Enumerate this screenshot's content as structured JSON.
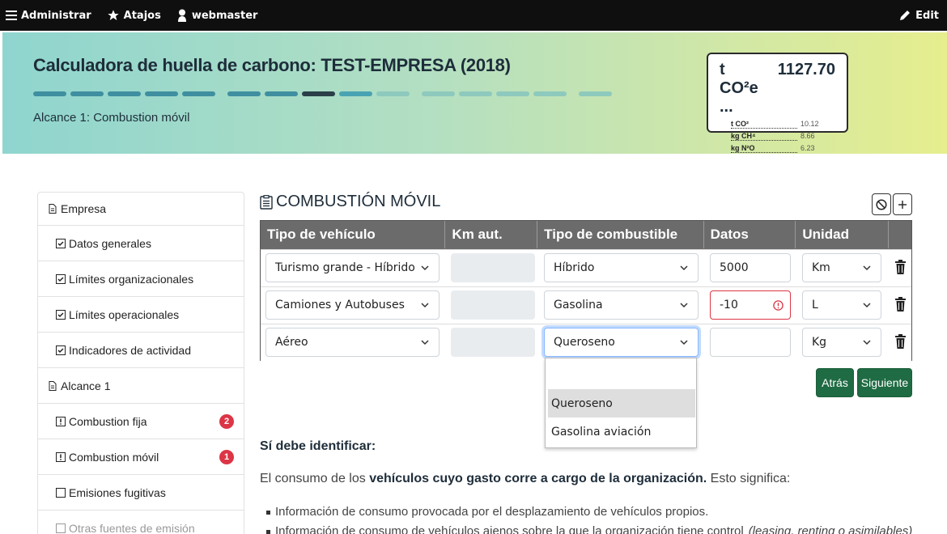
{
  "topbar": {
    "administrar": "Administrar",
    "atajos": "Atajos",
    "user": "webmaster",
    "edit": "Edit"
  },
  "hero": {
    "title": "Calculadora de huella de carbono: TEST-EMPRESA (2018)",
    "subtitle": "Alcance 1: Combustion móvil",
    "co2_label": "t CO²e ...",
    "co2_total": "1127.70",
    "rows": [
      {
        "label": "t CO²",
        "value": "10.12"
      },
      {
        "label": "kg CH⁴",
        "value": "8.66"
      },
      {
        "label": "kg N²O",
        "value": "6.23"
      }
    ],
    "progress_colors": {
      "done": "#3f8fa0",
      "current": "#2a3f48",
      "pending": "#8ec9bd",
      "next": "#4aa3b3"
    }
  },
  "sidebar": {
    "items": [
      {
        "label": "Empresa",
        "icon": "file-icon",
        "level": 1
      },
      {
        "label": "Datos generales",
        "icon": "check-square-icon",
        "level": 2
      },
      {
        "label": "Límites organizacionales",
        "icon": "check-square-icon",
        "level": 2
      },
      {
        "label": "Límites operacionales",
        "icon": "check-square-icon",
        "level": 2
      },
      {
        "label": "Indicadores de actividad",
        "icon": "check-square-icon",
        "level": 2
      },
      {
        "label": "Alcance 1",
        "icon": "file-icon",
        "level": 1
      },
      {
        "label": "Combustion fija",
        "icon": "exclamation-square-icon",
        "level": 2,
        "badge": "2"
      },
      {
        "label": "Combustion móvil",
        "icon": "exclamation-square-icon",
        "level": 2,
        "badge": "1"
      },
      {
        "label": "Emisiones fugitivas",
        "icon": "square-icon",
        "level": 2
      },
      {
        "label": "Otras fuentes de emisión",
        "icon": "square-icon",
        "level": 2
      }
    ]
  },
  "main": {
    "title": "COMBUSTIÓN MÓVIL",
    "columns": [
      "Tipo de vehículo",
      "Km aut.",
      "Tipo de combustible",
      "Datos",
      "Unidad"
    ],
    "rows": [
      {
        "vehicle": "Turismo grande - Híbrido",
        "km": "",
        "fuel": "Híbrido",
        "data": "5000",
        "unit": "Km"
      },
      {
        "vehicle": "Camiones y Autobuses",
        "km": "",
        "fuel": "Gasolina",
        "data": "-10",
        "unit": "L"
      },
      {
        "vehicle": "Aéreo",
        "km": "",
        "fuel": "Queroseno",
        "data": "",
        "unit": "Kg"
      }
    ],
    "dropdown_options": [
      "",
      "Queroseno",
      "Gasolina aviación"
    ],
    "back_label": "Atrás",
    "next_label": "Siguiente",
    "info_heading": "Sí debe identificar:",
    "info_text_pre": "El consumo de los ",
    "info_text_bold": "vehículos cuyo gasto corre a cargo de la organización.",
    "info_text_post": " Esto significa:",
    "bullets": [
      "Información de consumo provocada por el desplazamiento de vehículos propios.",
      "Información de consumo de vehículos ajenos sobre la que la organización tiene control",
      "(leasing, renting o asimilables)"
    ]
  }
}
